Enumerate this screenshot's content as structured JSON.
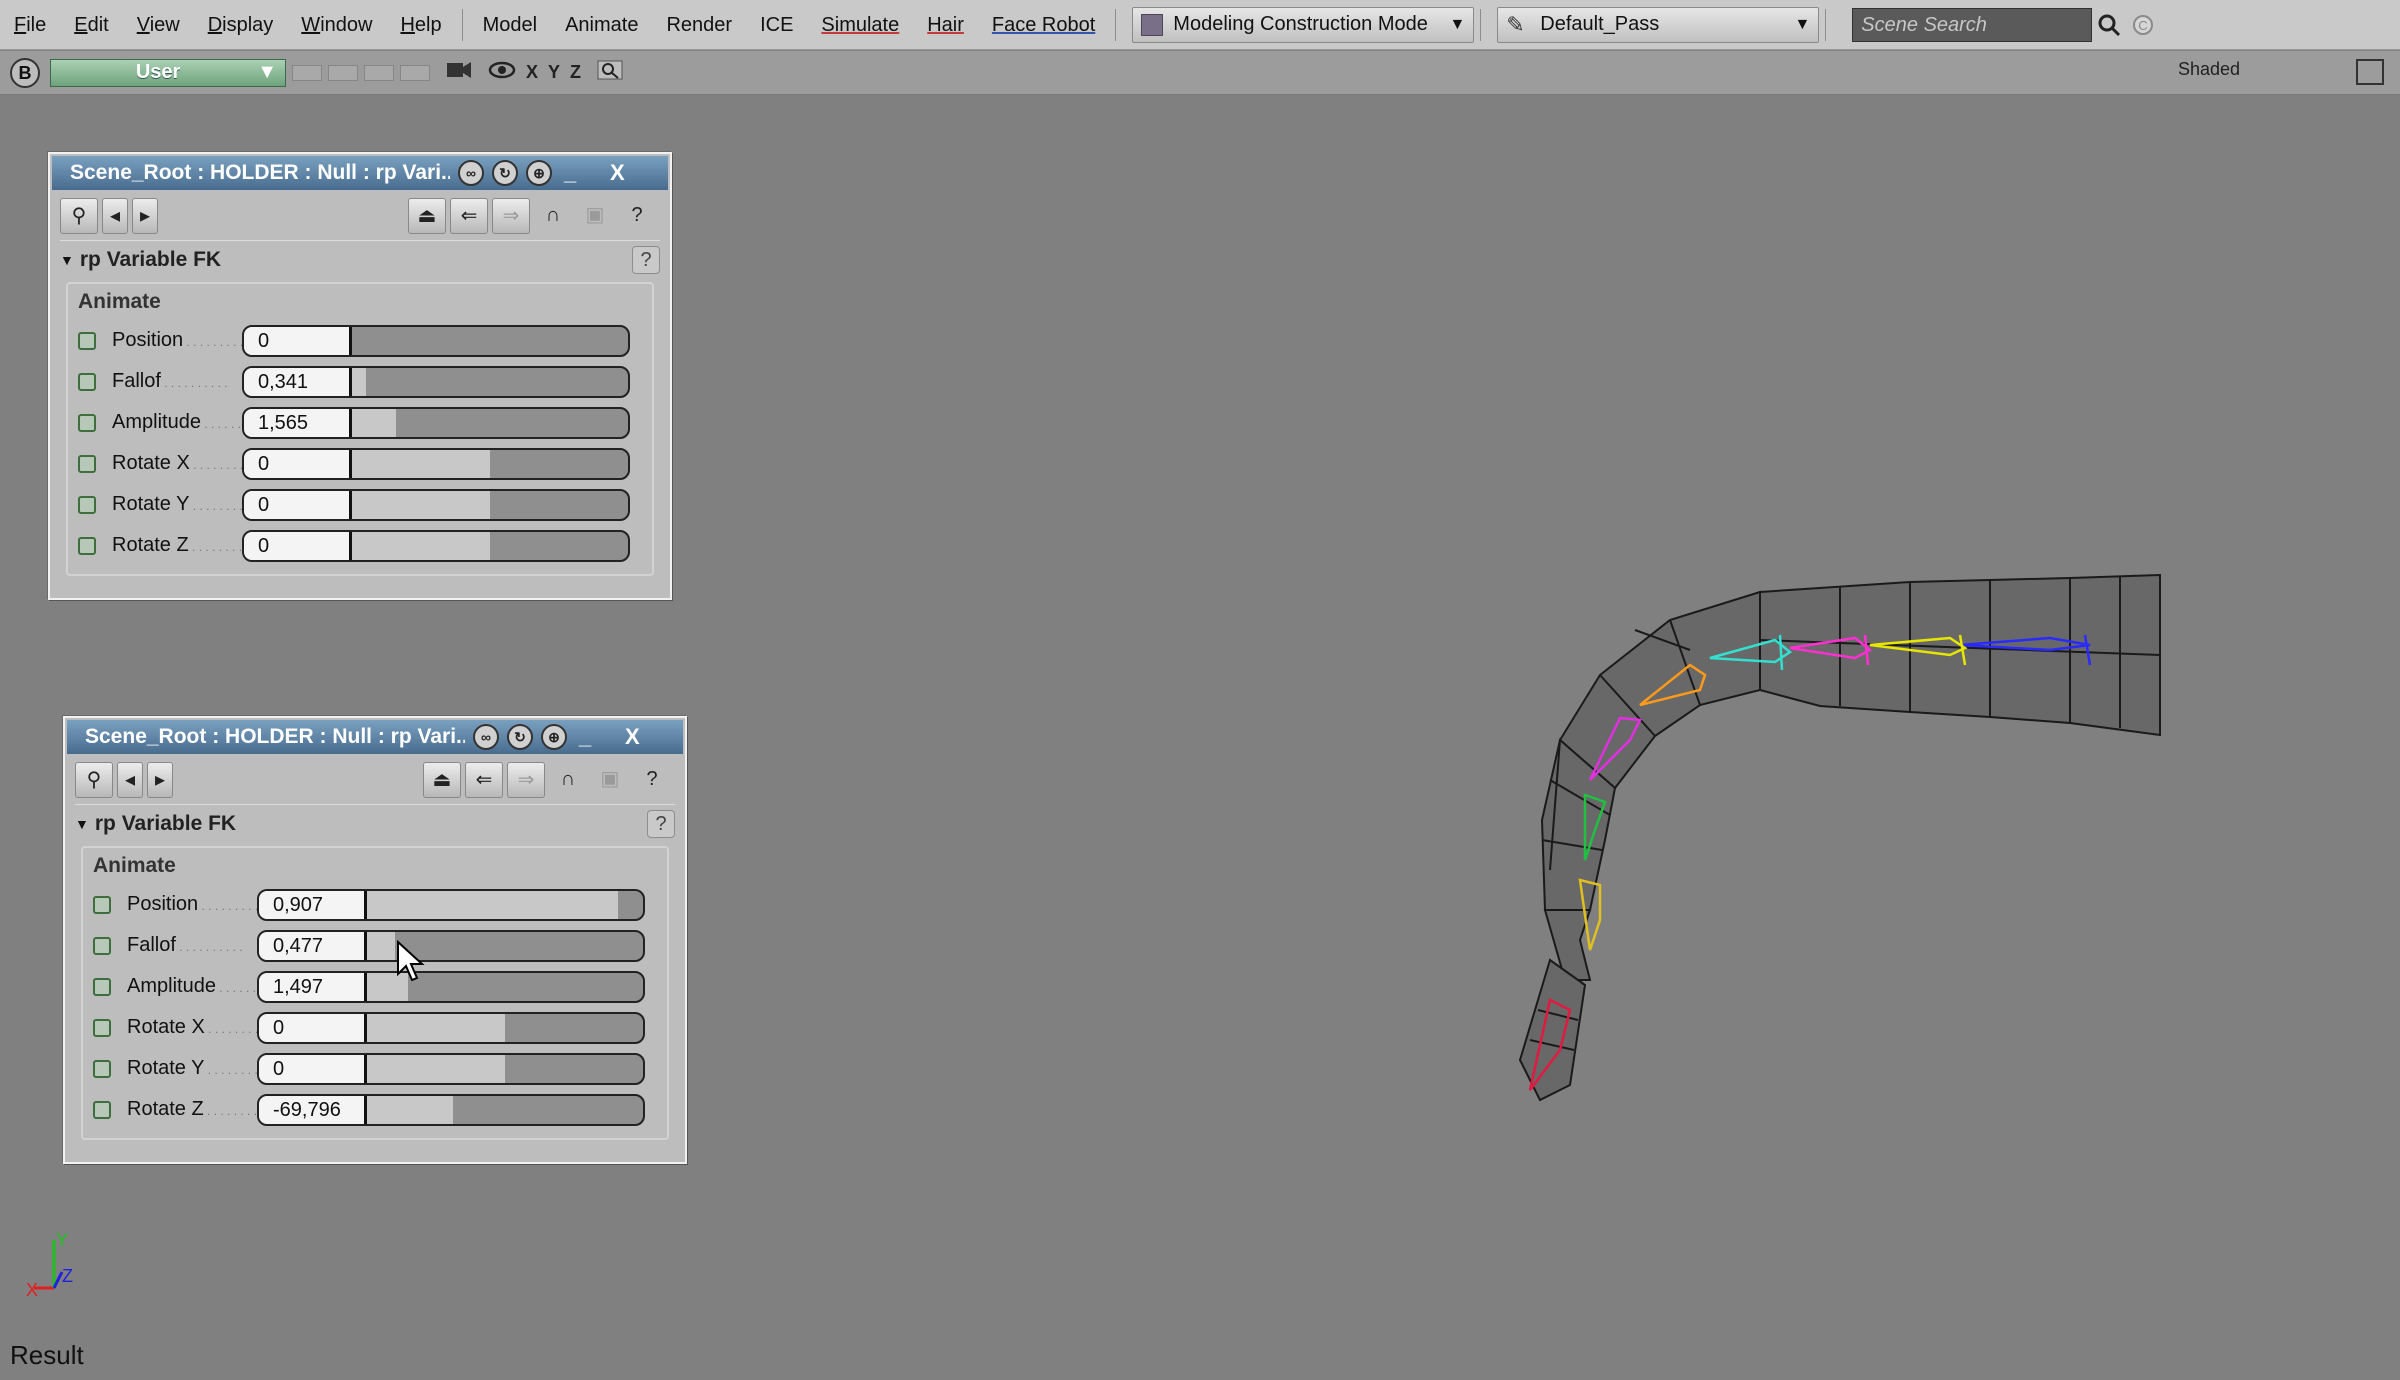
{
  "menubar": {
    "items": [
      "File",
      "Edit",
      "View",
      "Display",
      "Window",
      "Help"
    ],
    "items2": [
      "Model",
      "Animate",
      "Render",
      "ICE",
      "Simulate",
      "Hair",
      "Face Robot"
    ],
    "mode_label": "Modeling Construction Mode",
    "pass_label": "Default_Pass",
    "search_placeholder": "Scene Search"
  },
  "viewport": {
    "letter": "B",
    "camera": "User",
    "axes": [
      "X",
      "Y",
      "Z"
    ],
    "display_mode": "Shaded",
    "result_label": "Result",
    "gizmo_axes": [
      "X",
      "Y",
      "Z"
    ]
  },
  "panels": [
    {
      "title": "Scene_Root : HOLDER : Null : rp Vari...",
      "section": "rp Variable FK",
      "group": "Animate",
      "params": [
        {
          "label": "Position",
          "value": "0",
          "level": 0.0
        },
        {
          "label": "Fallof",
          "value": "0,341",
          "level": 0.05
        },
        {
          "label": "Amplitude",
          "value": "1,565",
          "level": 0.16
        },
        {
          "label": "Rotate X",
          "value": "0",
          "level": 0.5
        },
        {
          "label": "Rotate Y",
          "value": "0",
          "level": 0.5
        },
        {
          "label": "Rotate Z",
          "value": "0",
          "level": 0.5
        }
      ]
    },
    {
      "title": "Scene_Root : HOLDER : Null : rp Vari...",
      "section": "rp Variable FK",
      "group": "Animate",
      "params": [
        {
          "label": "Position",
          "value": "0,907",
          "level": 0.91
        },
        {
          "label": "Fallof",
          "value": "0,477",
          "level": 0.1
        },
        {
          "label": "Amplitude",
          "value": "1,497",
          "level": 0.15
        },
        {
          "label": "Rotate X",
          "value": "0",
          "level": 0.5
        },
        {
          "label": "Rotate Y",
          "value": "0",
          "level": 0.5
        },
        {
          "label": "Rotate Z",
          "value": "-69,796",
          "level": 0.31
        }
      ]
    }
  ],
  "colors": {
    "menubar_bg": "#c9c9c9",
    "viewport_bg": "#808080",
    "panel_title": "#5a7ea0",
    "camera_select": "#7fb08c"
  }
}
